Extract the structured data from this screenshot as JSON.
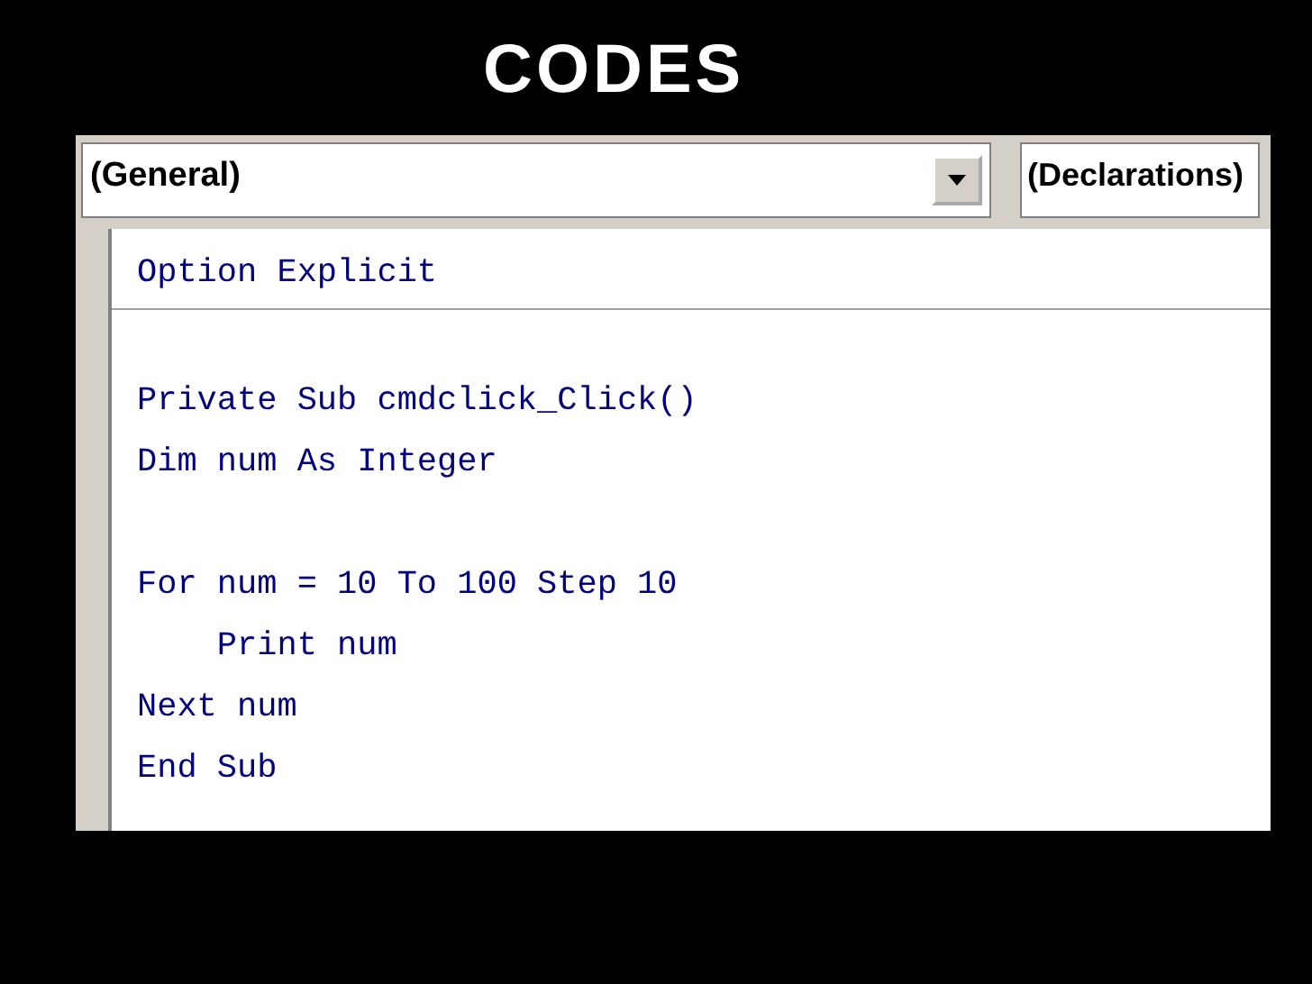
{
  "slide_title": "CODES",
  "code_window": {
    "object_combo": "(General)",
    "procedure_combo": "(Declarations)",
    "declarations": [
      "Option Explicit"
    ],
    "procedure_blocks": [
      [
        "Private Sub cmdclick_Click()",
        "Dim num As Integer"
      ],
      [
        "For num = 10 To 100 Step 10",
        "    Print num",
        "Next num",
        "End Sub"
      ]
    ]
  }
}
